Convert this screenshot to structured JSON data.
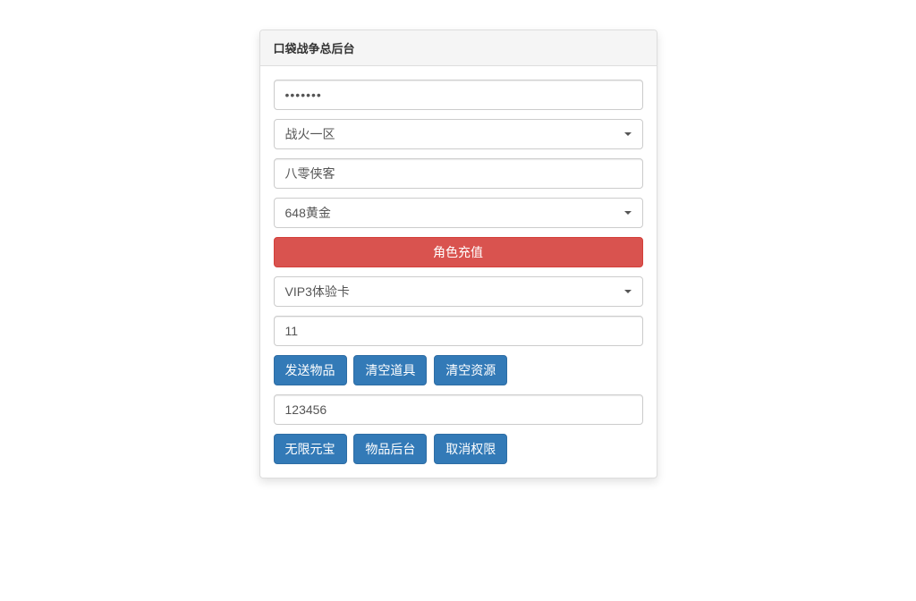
{
  "panel": {
    "title": "口袋战争总后台"
  },
  "form": {
    "password_value": "•••••••",
    "server_select": "战火一区",
    "role_name": "八零侠客",
    "recharge_select": "648黄金",
    "recharge_button": "角色充值",
    "card_select": "VIP3体验卡",
    "quantity_value": "11",
    "actions1": {
      "send_item": "发送物品",
      "clear_props": "清空道具",
      "clear_resources": "清空资源"
    },
    "code_value": "123456",
    "actions2": {
      "unlimited_gold": "无限元宝",
      "item_backend": "物品后台",
      "revoke_perm": "取消权限"
    }
  }
}
